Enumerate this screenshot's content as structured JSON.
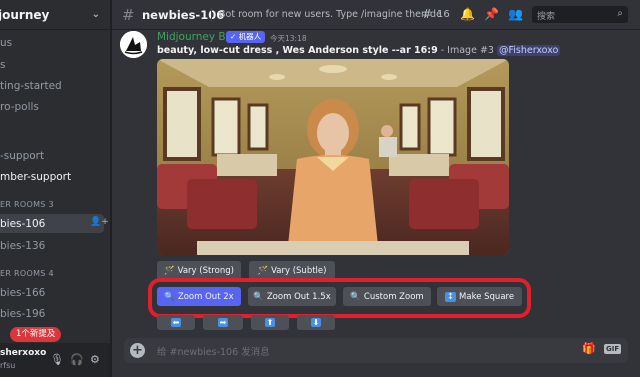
{
  "server": {
    "name": "journey"
  },
  "channels": [
    {
      "label": "us"
    },
    {
      "label": "s"
    },
    {
      "label": "ting-started"
    },
    {
      "label": "ro-polls"
    },
    {
      "label": "-support"
    },
    {
      "label": "mber-support"
    }
  ],
  "categories": [
    {
      "label": "ER ROOMS 3"
    },
    {
      "label": "ER ROOMS 4"
    }
  ],
  "rooms3": [
    {
      "label": "bies-106"
    },
    {
      "label": "bies-136"
    }
  ],
  "rooms4": [
    {
      "label": "bies-166"
    },
    {
      "label": "bies-196"
    }
  ],
  "unread_pill": "1个新提及",
  "user": {
    "name": "sherxoxo",
    "status": "rfsu"
  },
  "topbar": {
    "channel": "newbies-106",
    "topic": "Bot room for new users. Type /imagine then desc...",
    "thread_count": "16",
    "search_placeholder": "搜索"
  },
  "message": {
    "author": "Midjourney Bot",
    "bot_tag": "✓ 机器人",
    "timestamp": "今天13:18",
    "prompt": "beauty, low-cut dress , Wes Anderson style --ar 16:9",
    "suffix": " - Image #3 ",
    "mention": "@Fisherxoxo"
  },
  "buttons": {
    "vary_strong": "Vary (Strong)",
    "vary_subtle": "Vary (Subtle)",
    "zoom_out_2x": "Zoom Out 2x",
    "zoom_out_15x": "Zoom Out 1.5x",
    "custom_zoom": "Custom Zoom",
    "make_square": "Make Square"
  },
  "composer": {
    "placeholder": "给 #newbies-106 发消息"
  },
  "icons": {
    "hash": "hash-icon",
    "threads": "threads-icon",
    "bell": "bell-icon",
    "pin": "pin-icon",
    "members": "members-icon",
    "search": "search-icon",
    "arrows": [
      "arrow-left-icon",
      "arrow-right-icon",
      "arrow-up-icon",
      "arrow-down-icon"
    ]
  },
  "colors": {
    "background": "#313338",
    "sidebar": "#2b2d31",
    "primary_button": "#5865f2",
    "secondary_button": "#4e5058",
    "highlight": "#e0202c",
    "bot_name": "#3ba55c"
  }
}
